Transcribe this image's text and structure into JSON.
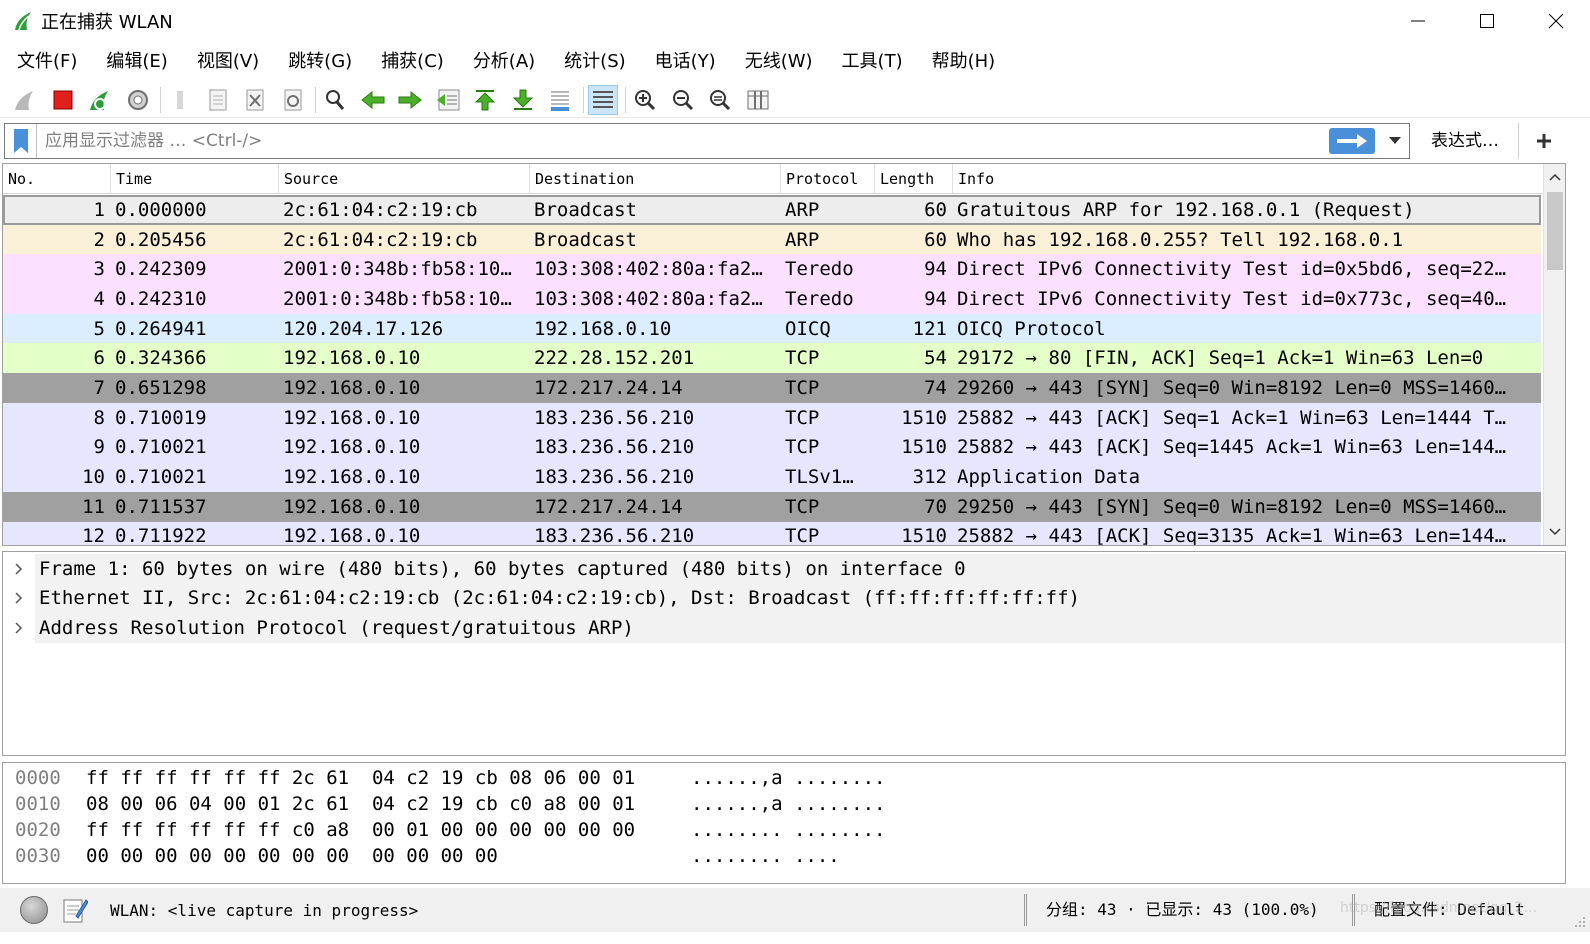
{
  "window": {
    "title": "正在捕获 WLAN"
  },
  "menu": [
    "文件(F)",
    "编辑(E)",
    "视图(V)",
    "跳转(G)",
    "捕获(C)",
    "分析(A)",
    "统计(S)",
    "电话(Y)",
    "无线(W)",
    "工具(T)",
    "帮助(H)"
  ],
  "filter": {
    "placeholder": "应用显示过滤器 … <Ctrl-/>",
    "value": "",
    "expression_label": "表达式…"
  },
  "columns": [
    "No.",
    "Time",
    "Source",
    "Destination",
    "Protocol",
    "Length",
    "Info"
  ],
  "packets": [
    {
      "no": "1",
      "time": "0.000000",
      "src": "2c:61:04:c2:19:cb",
      "dst": "Broadcast",
      "proto": "ARP",
      "len": "60",
      "info": "Gratuitous ARP for 192.168.0.1 (Request)",
      "bg": "#ededed"
    },
    {
      "no": "2",
      "time": "0.205456",
      "src": "2c:61:04:c2:19:cb",
      "dst": "Broadcast",
      "proto": "ARP",
      "len": "60",
      "info": "Who has 192.168.0.255? Tell 192.168.0.1",
      "bg": "#faf0d7"
    },
    {
      "no": "3",
      "time": "0.242309",
      "src": "2001:0:348b:fb58:10…",
      "dst": "103:308:402:80a:fa2…",
      "proto": "Teredo",
      "len": "94",
      "info": "Direct IPv6 Connectivity Test id=0x5bd6, seq=22…",
      "bg": "#fce0ff"
    },
    {
      "no": "4",
      "time": "0.242310",
      "src": "2001:0:348b:fb58:10…",
      "dst": "103:308:402:80a:fa2…",
      "proto": "Teredo",
      "len": "94",
      "info": "Direct IPv6 Connectivity Test id=0x773c, seq=40…",
      "bg": "#fce0ff"
    },
    {
      "no": "5",
      "time": "0.264941",
      "src": "120.204.17.126",
      "dst": "192.168.0.10",
      "proto": "OICQ",
      "len": "121",
      "info": "OICQ Protocol",
      "bg": "#daeeff"
    },
    {
      "no": "6",
      "time": "0.324366",
      "src": "192.168.0.10",
      "dst": "222.28.152.201",
      "proto": "TCP",
      "len": "54",
      "info": "29172 → 80 [FIN, ACK] Seq=1 Ack=1 Win=63 Len=0",
      "bg": "#e4ffc7"
    },
    {
      "no": "7",
      "time": "0.651298",
      "src": "192.168.0.10",
      "dst": "172.217.24.14",
      "proto": "TCP",
      "len": "74",
      "info": "29260 → 443 [SYN] Seq=0 Win=8192 Len=0 MSS=1460…",
      "bg": "#a0a0a0"
    },
    {
      "no": "8",
      "time": "0.710019",
      "src": "192.168.0.10",
      "dst": "183.236.56.210",
      "proto": "TCP",
      "len": "1510",
      "info": "25882 → 443 [ACK] Seq=1 Ack=1 Win=63 Len=1444 T…",
      "bg": "#e7e6ff"
    },
    {
      "no": "9",
      "time": "0.710021",
      "src": "192.168.0.10",
      "dst": "183.236.56.210",
      "proto": "TCP",
      "len": "1510",
      "info": "25882 → 443 [ACK] Seq=1445 Ack=1 Win=63 Len=144…",
      "bg": "#e7e6ff"
    },
    {
      "no": "10",
      "time": "0.710021",
      "src": "192.168.0.10",
      "dst": "183.236.56.210",
      "proto": "TLSv1…",
      "len": "312",
      "info": "Application Data",
      "bg": "#e7e6ff"
    },
    {
      "no": "11",
      "time": "0.711537",
      "src": "192.168.0.10",
      "dst": "172.217.24.14",
      "proto": "TCP",
      "len": "70",
      "info": "29250 → 443 [SYN] Seq=0 Win=8192 Len=0 MSS=1460…",
      "bg": "#a0a0a0"
    },
    {
      "no": "12",
      "time": "0.711922",
      "src": "192.168.0.10",
      "dst": "183.236.56.210",
      "proto": "TCP",
      "len": "1510",
      "info": "25882 → 443 [ACK] Seq=3135 Ack=1 Win=63 Len=144…",
      "bg": "#e7e6ff"
    }
  ],
  "details": [
    "Frame 1: 60 bytes on wire (480 bits), 60 bytes captured (480 bits) on interface 0",
    "Ethernet II, Src: 2c:61:04:c2:19:cb (2c:61:04:c2:19:cb), Dst: Broadcast (ff:ff:ff:ff:ff:ff)",
    "Address Resolution Protocol (request/gratuitous ARP)"
  ],
  "bytes": [
    {
      "offset": "0000",
      "hex": "ff ff ff ff ff ff 2c 61  04 c2 19 cb 08 06 00 01",
      "ascii": "......,a ........"
    },
    {
      "offset": "0010",
      "hex": "08 00 06 04 00 01 2c 61  04 c2 19 cb c0 a8 00 01",
      "ascii": "......,a ........"
    },
    {
      "offset": "0020",
      "hex": "ff ff ff ff ff ff c0 a8  00 01 00 00 00 00 00 00",
      "ascii": "........ ........"
    },
    {
      "offset": "0030",
      "hex": "00 00 00 00 00 00 00 00  00 00 00 00",
      "ascii": "........ ...."
    }
  ],
  "status": {
    "capture": "WLAN: <live capture in progress>",
    "packets": "分组: 43 · 已显示: 43 (100.0%)",
    "profile": "配置文件: Default"
  },
  "watermark": "https://blog.csdn.net/qq_2…"
}
